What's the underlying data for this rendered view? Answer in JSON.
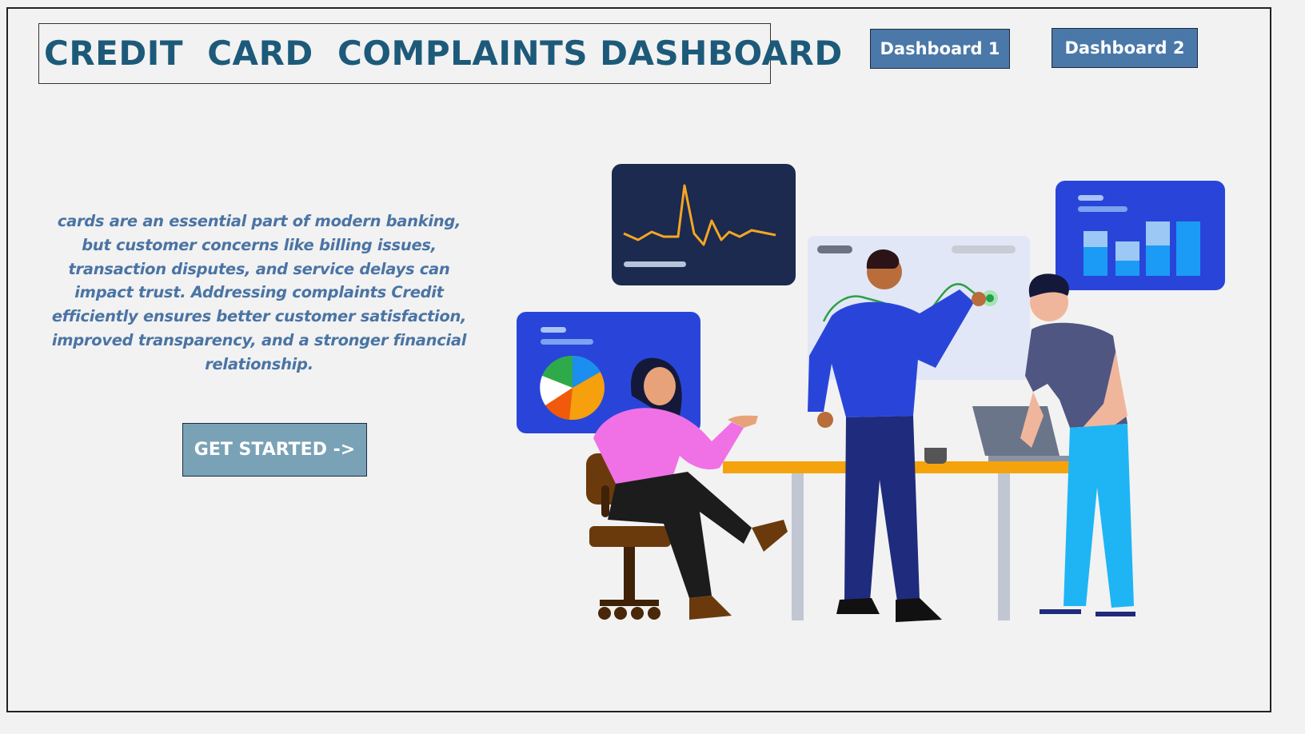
{
  "header": {
    "title": "CREDIT  CARD  COMPLAINTS DASHBOARD",
    "nav": [
      {
        "label": "Dashboard 1"
      },
      {
        "label": "Dashboard 2"
      }
    ]
  },
  "main": {
    "intro_text": "cards are an essential part of modern banking, but customer concerns like billing issues, transaction disputes, and service delays can impact trust. Addressing complaints Credit efficiently ensures better customer satisfaction, improved transparency, and a stronger financial relationship.",
    "cta_label": "GET STARTED ->"
  },
  "colors": {
    "title": "#1d5a7a",
    "nav_button": "#4a78a8",
    "cta_button": "#7aa2b6",
    "intro_text": "#4a74a4",
    "background": "#f2f2f2"
  },
  "illustration": {
    "icons": [
      "line-chart-card-icon",
      "pie-chart-card-icon",
      "bar-chart-card-icon",
      "team-meeting-illustration"
    ]
  }
}
